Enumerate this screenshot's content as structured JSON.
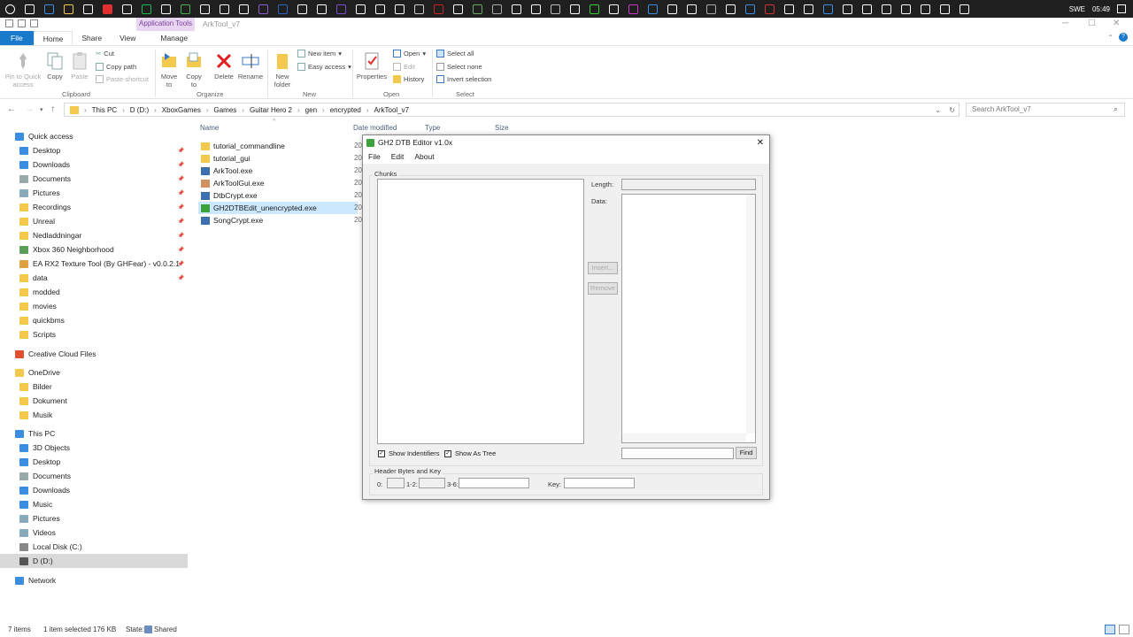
{
  "taskbar": {
    "icons": [
      "start-icon",
      "search-icon",
      "edge-icon",
      "explorer-icon",
      "mail-icon",
      "app-icon",
      "store-icon",
      "spotify-icon",
      "app-icon",
      "gamepad-icon",
      "steam-icon",
      "unreal-icon",
      "xbox-icon",
      "vs-icon",
      "word-icon",
      "doc-icon",
      "app-icon",
      "app-icon",
      "app-icon",
      "app-icon",
      "app-icon",
      "app-icon",
      "filezilla-icon",
      "app-icon",
      "app-icon",
      "app-icon",
      "app-icon",
      "app-icon",
      "app-icon",
      "app-icon",
      "app-icon",
      "app-icon",
      "app-icon",
      "app-icon",
      "app-icon",
      "app-icon",
      "app-icon",
      "app-icon",
      "app-icon",
      "app-icon",
      "app-icon",
      "app-icon",
      "app-icon",
      "app-icon",
      "app-icon",
      "app-icon",
      "app-icon",
      "app-icon",
      "app-icon",
      "app-icon"
    ],
    "lang": "SWE",
    "time": "05:49"
  },
  "window": {
    "context_tab": "Application Tools",
    "title": "ArkTool_v7"
  },
  "ribbon_tabs": [
    "File",
    "Home",
    "Share",
    "View",
    "Manage"
  ],
  "ribbon": {
    "pin_label": "Pin to Quick access",
    "copy": "Copy",
    "paste": "Paste",
    "cut": "Cut",
    "copy_path": "Copy path",
    "paste_shortcut": "Paste shortcut",
    "clipboard": "Clipboard",
    "move_to": "Move to",
    "copy_to": "Copy to",
    "delete": "Delete",
    "rename": "Rename",
    "organize": "Organize",
    "new_folder": "New folder",
    "new_item": "New item",
    "easy_access": "Easy access",
    "new": "New",
    "properties": "Properties",
    "open": "Open",
    "edit": "Edit",
    "history": "History",
    "open_group": "Open",
    "select_all": "Select all",
    "select_none": "Select none",
    "invert_selection": "Invert selection",
    "select": "Select"
  },
  "address": {
    "crumbs": [
      "This PC",
      "D (D:)",
      "XboxGames",
      "Games",
      "Guitar Hero 2",
      "gen",
      "encrypted",
      "ArkTool_v7"
    ],
    "search_placeholder": "Search ArkTool_v7"
  },
  "nav": {
    "quick_access": "Quick access",
    "items": [
      {
        "label": "Desktop",
        "pinned": true
      },
      {
        "label": "Downloads",
        "pinned": true
      },
      {
        "label": "Documents",
        "pinned": true
      },
      {
        "label": "Pictures",
        "pinned": true
      },
      {
        "label": "Recordings",
        "pinned": true
      },
      {
        "label": "Unreal",
        "pinned": true
      },
      {
        "label": "Nedladdningar",
        "pinned": true
      },
      {
        "label": "Xbox 360 Neighborhood",
        "pinned": true
      },
      {
        "label": "EA RX2 Texture Tool (By GHFear) - v0.0.2.1",
        "pinned": true
      },
      {
        "label": "data",
        "pinned": true
      },
      {
        "label": "modded",
        "pinned": false
      },
      {
        "label": "movies",
        "pinned": false
      },
      {
        "label": "quickbms",
        "pinned": false
      },
      {
        "label": "Scripts",
        "pinned": false
      }
    ],
    "creative_cloud": "Creative Cloud Files",
    "onedrive": "OneDrive",
    "onedrive_items": [
      "Bilder",
      "Dokument",
      "Musik"
    ],
    "this_pc": "This PC",
    "pc_items": [
      "3D Objects",
      "Desktop",
      "Documents",
      "Downloads",
      "Music",
      "Pictures",
      "Videos",
      "Local Disk (C:)",
      "D (D:)"
    ],
    "network": "Network"
  },
  "files": {
    "columns": [
      "Name",
      "Date modified",
      "Type",
      "Size"
    ],
    "rows": [
      {
        "name": "tutorial_commandline",
        "date": "20"
      },
      {
        "name": "tutorial_gui",
        "date": "20"
      },
      {
        "name": "ArkTool.exe",
        "date": "20"
      },
      {
        "name": "ArkToolGui.exe",
        "date": "20"
      },
      {
        "name": "DtbCrypt.exe",
        "date": "20"
      },
      {
        "name": "GH2DTBEdit_unencrypted.exe",
        "date": "20"
      },
      {
        "name": "SongCrypt.exe",
        "date": "20"
      }
    ]
  },
  "dialog": {
    "title": "GH2 DTB Editor v1.0x",
    "menu": [
      "File",
      "Edit",
      "About"
    ],
    "chunks": "Chunks",
    "length": "Length:",
    "data": "Data:",
    "insert": "Insert...",
    "remove": "Remove",
    "show_identifiers": "Show Indentifiers",
    "show_as_tree": "Show As Tree",
    "find": "Find",
    "header_group": "Header Bytes and Key",
    "f0": "0:",
    "f12": "1-2:",
    "f36": "3-6:",
    "key": "Key:"
  },
  "status": {
    "items": "7 items",
    "selected": "1 item selected  176 KB",
    "state": "State:",
    "shared": "Shared"
  }
}
